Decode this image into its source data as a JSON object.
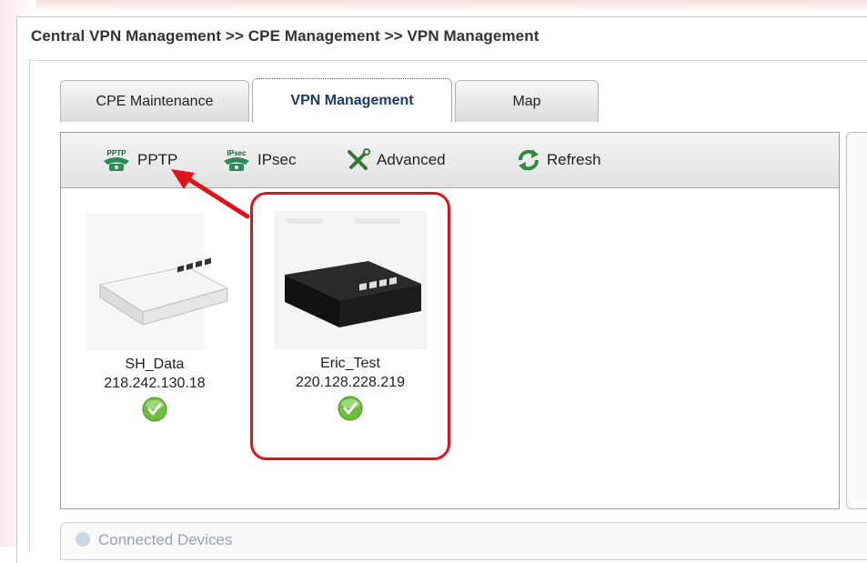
{
  "breadcrumb": "Central VPN Management >> CPE Management >> VPN Management",
  "tabs": [
    {
      "label": "CPE Maintenance",
      "active": false
    },
    {
      "label": "VPN Management",
      "active": true
    },
    {
      "label": "Map",
      "active": false
    }
  ],
  "toolbar": {
    "pptp_icon_text": "PPTP",
    "pptp": "PPTP",
    "ipsec_icon_text": "IPsec",
    "ipsec": "IPsec",
    "advanced": "Advanced",
    "refresh": "Refresh"
  },
  "devices": [
    {
      "name": "SH_Data",
      "ip": "218.242.130.18",
      "status": "check-icon"
    },
    {
      "name": "Eric_Test",
      "ip": "220.128.228.219",
      "status": "check-icon"
    }
  ],
  "bottom_section": {
    "title": "Connected Devices"
  },
  "colors": {
    "highlight": "#e0131b",
    "arrow": "#e0131b",
    "check": "#6cbf3a",
    "tab_active_text": "#1a3a6b"
  }
}
